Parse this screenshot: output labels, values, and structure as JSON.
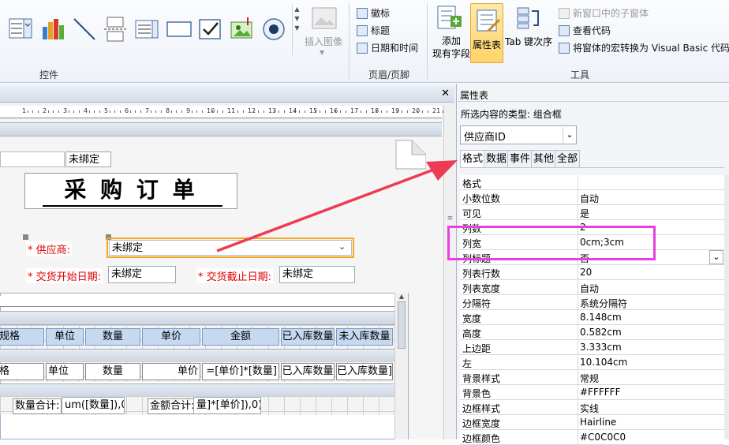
{
  "ribbon": {
    "controls_group": "控件",
    "insert_image": "插入图像",
    "header_footer": {
      "logo": "徽标",
      "title": "标题",
      "datetime": "日期和时间",
      "group": "页眉/页脚"
    },
    "tools": {
      "add_field": "添加\n现有字段",
      "add_field_l1": "添加",
      "add_field_l2": "现有字段",
      "property_sheet": "属性表",
      "tab_order": "Tab 键次序",
      "subform": "新窗口中的子窗体",
      "view_code": "查看代码",
      "convert_macros": "将窗体的宏转换为 Visual Basic 代码",
      "group": "工具"
    }
  },
  "form": {
    "unbound_top": "未绑定",
    "title": "采 购 订 单",
    "supplier_label": "* 供应商:",
    "supplier_value": "未绑定",
    "start_date_label": "* 交货开始日期:",
    "start_date_value": "未绑定",
    "end_date_label": "* 交货截止日期:",
    "end_date_value": "未绑定",
    "headers": [
      "规格",
      "单位",
      "数量",
      "单价",
      "金额",
      "已入库数量",
      "未入库数量"
    ],
    "details": [
      "格",
      "单位",
      "数量",
      "单价",
      "=[单价]*[数量]",
      "已入库数量",
      "已入库数量]"
    ],
    "qty_total_label": "数量合计:",
    "qty_total_value": "um([数量]),0)",
    "amt_total_label": "金额合计:",
    "amt_total_value": "量]*[单价]),0)"
  },
  "ruler_ticks": [
    "1",
    "2",
    "3",
    "4",
    "5",
    "6",
    "7",
    "8",
    "9",
    "10",
    "11",
    "12",
    "13",
    "14",
    "15",
    "16",
    "17",
    "18",
    "19",
    "20",
    "21"
  ],
  "props": {
    "header": "属性表",
    "close": "×",
    "selection_type": "所选内容的类型: 组合框",
    "selected_control": "供应商ID",
    "tabs": [
      "格式",
      "数据",
      "事件",
      "其他",
      "全部"
    ],
    "rows": [
      {
        "k": "格式",
        "v": ""
      },
      {
        "k": "小数位数",
        "v": "自动"
      },
      {
        "k": "可见",
        "v": "是"
      },
      {
        "k": "列数",
        "v": "2"
      },
      {
        "k": "列宽",
        "v": "0cm;3cm"
      },
      {
        "k": "列标题",
        "v": "否"
      },
      {
        "k": "列表行数",
        "v": "20"
      },
      {
        "k": "列表宽度",
        "v": "自动"
      },
      {
        "k": "分隔符",
        "v": "系统分隔符"
      },
      {
        "k": "宽度",
        "v": "8.148cm"
      },
      {
        "k": "高度",
        "v": "0.582cm"
      },
      {
        "k": "上边距",
        "v": "3.333cm"
      },
      {
        "k": "左",
        "v": "10.104cm"
      },
      {
        "k": "背景样式",
        "v": "常规"
      },
      {
        "k": "背景色",
        "v": "#FFFFFF"
      },
      {
        "k": "边框样式",
        "v": "实线"
      },
      {
        "k": "边框宽度",
        "v": "Hairline"
      },
      {
        "k": "边框颜色",
        "v": "#C0C0C0"
      }
    ]
  },
  "colors": {
    "highlight": "#e83fe0",
    "arrow": "#ec3b55",
    "selection": "#f5a623",
    "required_label": "#e00000"
  }
}
